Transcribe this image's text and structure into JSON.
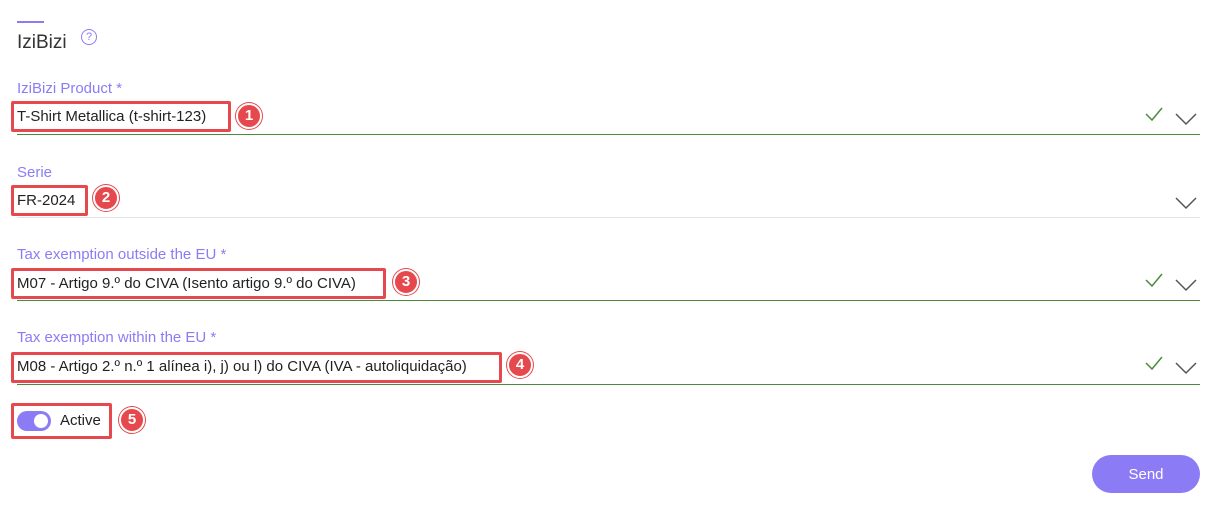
{
  "section": {
    "title": "IziBizi",
    "help_glyph": "?"
  },
  "fields": [
    {
      "label": "IziBizi Product *",
      "value": "T-Shirt Metallica (t-shirt-123)",
      "valid": true,
      "annotation": "1"
    },
    {
      "label": "Serie",
      "value": "FR-2024",
      "valid": false,
      "annotation": "2"
    },
    {
      "label": "Tax exemption outside the EU *",
      "value": "M07 - Artigo 9.º do CIVA (Isento artigo 9.º do CIVA)",
      "valid": true,
      "annotation": "3"
    },
    {
      "label": "Tax exemption within the EU *",
      "value": "M08 - Artigo 2.º n.º 1 alínea i), j) ou l) do CIVA (IVA - autoliquidação)",
      "valid": true,
      "annotation": "4"
    }
  ],
  "toggle": {
    "label": "Active",
    "on": true,
    "annotation": "5"
  },
  "actions": {
    "send_label": "Send"
  },
  "colors": {
    "accent": "#8b7cf6",
    "valid": "#4b8b3b",
    "annotation": "#e5484d"
  }
}
